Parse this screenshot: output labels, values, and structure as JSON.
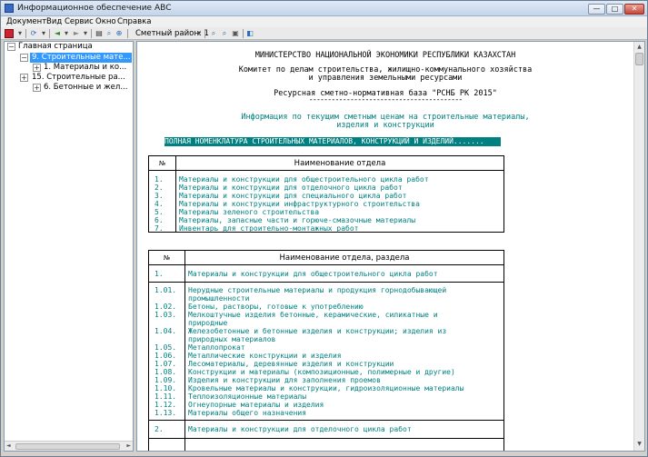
{
  "window": {
    "title": "Информационное обеспечение АВС",
    "min_glyph": "—",
    "max_glyph": "□",
    "close_glyph": "✕"
  },
  "menu": [
    "Документ",
    "Вид",
    "Сервис",
    "Окно",
    "Справка"
  ],
  "toolbar": {
    "region_label": "Сметный район: 1"
  },
  "tree": {
    "items": [
      {
        "label": "Главная страница"
      },
      {
        "label": "9. Строительные мате..."
      },
      {
        "label": "1. Материалы и ко..."
      },
      {
        "label": "15. Строительные ра..."
      },
      {
        "label": "6. Бетонные и жел..."
      }
    ],
    "selected_index": 1
  },
  "document": {
    "ministry": "МИНИСТЕРСТВО НАЦИОНАЛЬНОЙ ЭКОНОМИКИ РЕСПУБЛИКИ КАЗАХСТАН",
    "committee_line1": "Комитет по делам строительства, жилищно-коммунального хозяйства",
    "committee_line2": "и управления земельными ресурсами",
    "base_title": "Ресурсная сметно-нормативная база \"РСНБ РК 2015\"",
    "underline": "-----------------------------------------",
    "info_line1": "Информация по текущим сметным ценам на строительные материалы,",
    "info_line2": "изделия и конструкции",
    "highlight": "ПОЛНАЯ НОМЕНКЛАТУРА СТРОИТЕЛЬНЫХ МАТЕРИАЛОВ, КОНСТРУКЦИЙ И ИЗДЕЛИЙ.......",
    "table1": {
      "num_header": "№",
      "title_header": "Наименование отдела",
      "rows": [
        {
          "n": "1.",
          "t": "Материалы и конструкции для общестроительного цикла работ"
        },
        {
          "n": "2.",
          "t": "Материалы и конструкции для отделочного цикла работ"
        },
        {
          "n": "3.",
          "t": "Материалы и конструкции для специального цикла работ"
        },
        {
          "n": "4.",
          "t": "Материалы и конструкции инфраструктурного строительства"
        },
        {
          "n": "5.",
          "t": "Материалы зеленого строительства"
        },
        {
          "n": "6.",
          "t": "Материалы, запасные части и горюче-смазочные материалы"
        },
        {
          "n": "7.",
          "t": "Инвентарь для строительно-монтажных работ"
        }
      ]
    },
    "table2": {
      "num_header": "№",
      "title_header": "Наименование отдела, раздела",
      "section1": {
        "n": "1.",
        "t": "Материалы и конструкции для общестроительного цикла работ"
      },
      "rows": [
        {
          "n": "1.01.",
          "t": "Нерудные строительные материалы и продукция горнодобывающей промышленности"
        },
        {
          "n": "1.02.",
          "t": "Бетоны, растворы, готовые к употреблению"
        },
        {
          "n": "1.03.",
          "t": "Мелкоштучные изделия бетонные, керамические, силикатные и природные"
        },
        {
          "n": "1.04.",
          "t": "Железобетонные и бетонные изделия и конструкции; изделия из природных материалов"
        },
        {
          "n": "1.05.",
          "t": "Металлопрокат"
        },
        {
          "n": "1.06.",
          "t": "Металлические конструкции и изделия"
        },
        {
          "n": "1.07.",
          "t": "Лесоматериалы, деревянные изделия и конструкции"
        },
        {
          "n": "1.08.",
          "t": "Конструкции и материалы (композиционные, полимерные и другие)"
        },
        {
          "n": "1.09.",
          "t": "Изделия и конструкции для заполнения проемов"
        },
        {
          "n": "1.10.",
          "t": "Кровельные материалы и конструкции, гидроизоляционные материалы"
        },
        {
          "n": "1.11.",
          "t": "Теплоизоляционные материалы"
        },
        {
          "n": "1.12.",
          "t": "Огнеупорные материалы и изделия"
        },
        {
          "n": "1.13.",
          "t": "Материалы общего назначения"
        }
      ],
      "section2": {
        "n": "2.",
        "t": "Материалы и конструкции для отделочного цикла работ"
      }
    }
  }
}
